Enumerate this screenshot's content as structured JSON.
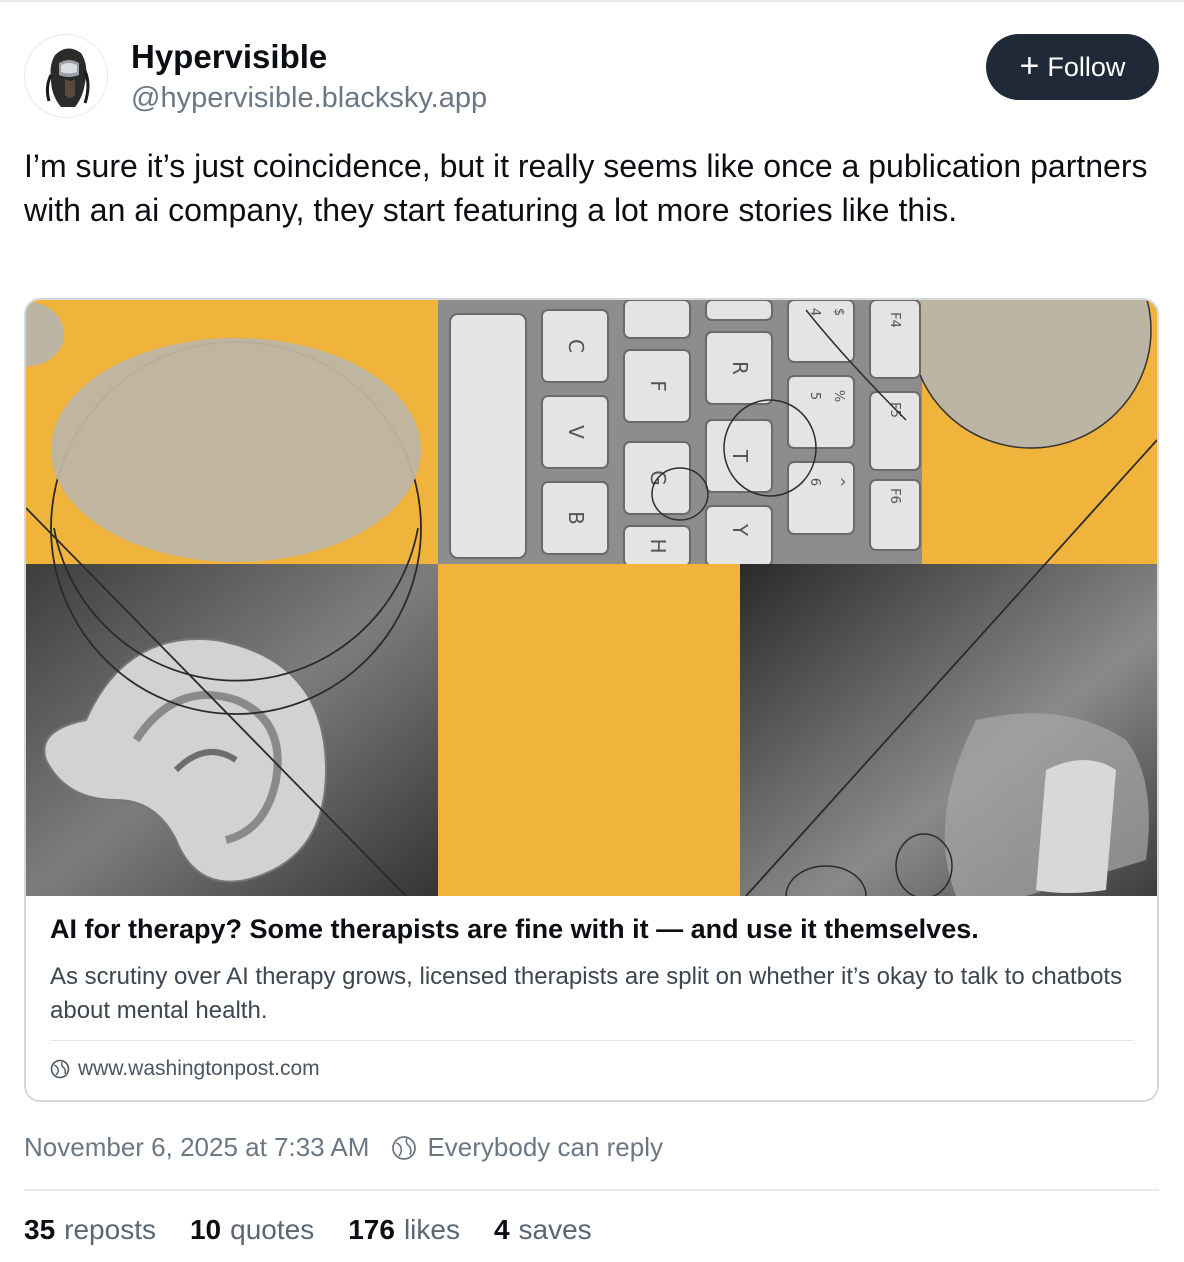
{
  "author": {
    "display_name": "Hypervisible",
    "handle": "@hypervisible.blacksky.app"
  },
  "follow_button": {
    "label": "Follow",
    "icon": "plus-icon"
  },
  "post": {
    "text": "I’m sure it’s just coincidence, but it really seems like once a publication partners with an ai company, they start featuring a lot more stories like this."
  },
  "link_card": {
    "title": "AI for therapy? Some therapists are fine with it — and use it themselves.",
    "description": "As scrutiny over AI therapy grows, licensed therapists are split on whether it’s okay to talk to chatbots about mental health.",
    "domain": "www.washingtonpost.com",
    "domain_icon": "globe-icon",
    "image_keys": [
      "C",
      "V",
      "B",
      "F",
      "G",
      "H",
      "R",
      "T",
      "Y",
      "$",
      "4",
      "%",
      "5",
      "^",
      "6",
      "F4",
      "F5",
      "F6"
    ]
  },
  "meta": {
    "timestamp": "November 6, 2025 at 7:33 AM",
    "reply_setting": "Everybody can reply",
    "reply_icon": "globe-icon"
  },
  "stats": {
    "reposts_count": "35",
    "reposts_label": "reposts",
    "quotes_count": "10",
    "quotes_label": "quotes",
    "likes_count": "176",
    "likes_label": "likes",
    "saves_count": "4",
    "saves_label": "saves"
  },
  "colors": {
    "accent_dark": "#1f2937",
    "image_yellow": "#f0b43c",
    "muted_text": "#6b7785"
  }
}
